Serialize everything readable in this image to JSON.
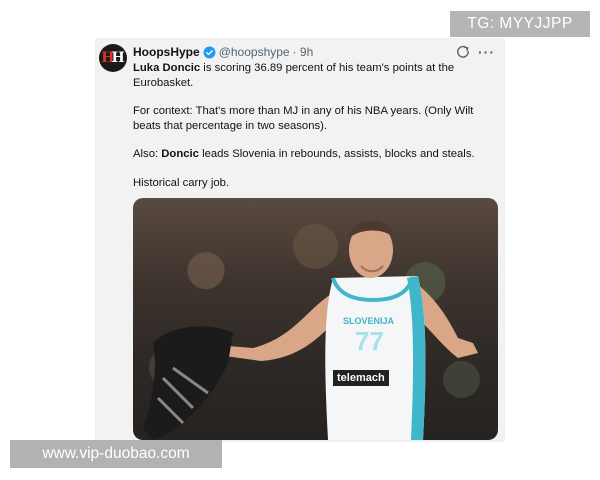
{
  "watermark_top": "TG: MYYJJPP",
  "watermark_bottom": "www.vip-duobao.com",
  "tweet": {
    "display_name": "HoopsHype",
    "handle": "@hoopshype",
    "time": "· 9h",
    "line1_bold": "Luka Doncic",
    "line1_rest": " is scoring 36.89 percent of his team's points at the Eurobasket.",
    "para2": "For context: That's more than MJ in any of his NBA years. (Only Wilt beats that percentage in two seasons).",
    "para3_pre": "Also: ",
    "para3_bold": "Doncic",
    "para3_rest": " leads Slovenia in rebounds, assists, blocks and steals.",
    "para4": "Historical carry job.",
    "jersey_text": "SLOVENIJA",
    "jersey_number": "77",
    "sponsor": "telemach"
  },
  "colors": {
    "verified": "#1d9bf0",
    "jersey_accent": "#3fb6c9"
  },
  "icons": {
    "verified": "verified-badge-icon",
    "grok": "grok-icon",
    "more": "more-icon"
  }
}
